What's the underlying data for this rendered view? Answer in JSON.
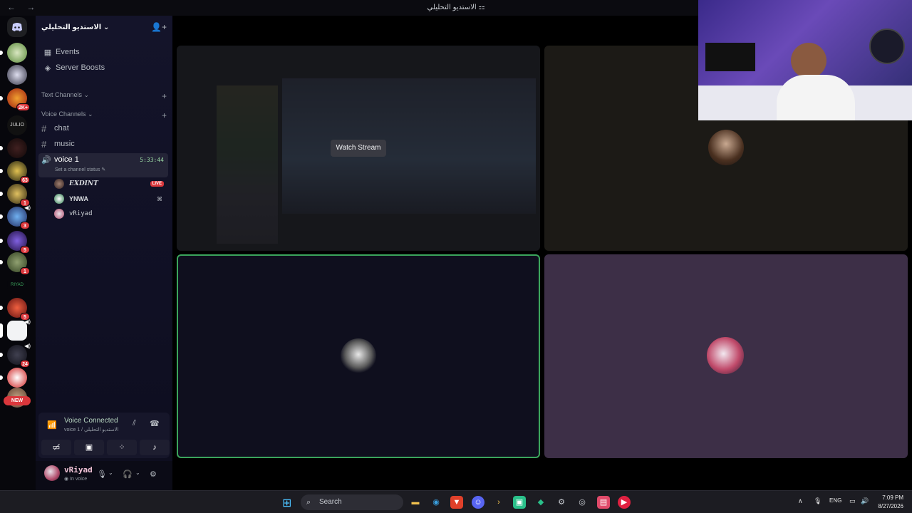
{
  "window": {
    "title": "الاستديو التحليلي ⚏",
    "nav": "← →"
  },
  "server": {
    "name": "الاستديو التحليلي"
  },
  "rail": {
    "badges": [
      "2K+",
      "63",
      "1",
      "3",
      "5",
      "1",
      "5",
      "24"
    ],
    "new_label": "NEW"
  },
  "sidebar": {
    "events": "Events",
    "boosts": "Server Boosts",
    "text_channels": "Text Channels",
    "voice_channels": "Voice Channels",
    "channels": [
      "chat",
      "music"
    ],
    "voice_channel": {
      "name": "voice 1",
      "time": "5:33:44",
      "status": "Set a channel status"
    },
    "members": [
      {
        "name": "EXDINT",
        "badge": "LIVE"
      },
      {
        "name": "YNWA"
      },
      {
        "name": "vRiyad"
      }
    ]
  },
  "voice": {
    "title": "Voice Connected",
    "subtitle": "voice 1 / الاستديو التحليلي"
  },
  "user": {
    "name": "vRiyad",
    "status": "In voice"
  },
  "stage": {
    "watch_label": "Watch Stream"
  },
  "taskbar": {
    "search": "Search",
    "lang": "ENG",
    "time": "7:09 PM",
    "date": "8/27/2026"
  }
}
